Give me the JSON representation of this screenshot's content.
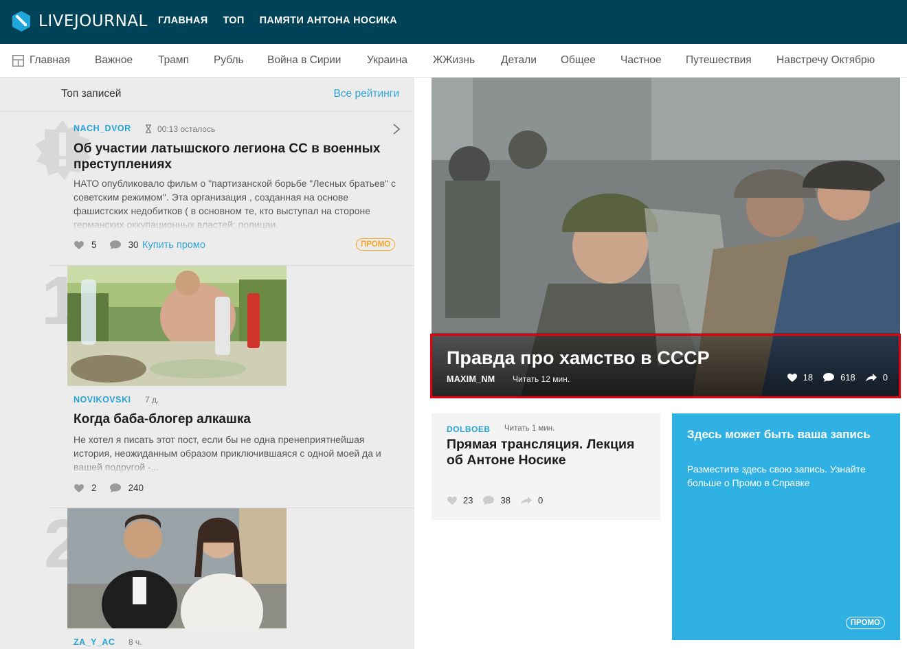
{
  "header": {
    "logo_text": "LIVEJOURNAL",
    "nav": [
      "ГЛАВНАЯ",
      "ТОП",
      "ПАМЯТИ АНТОНА НОСИКА"
    ]
  },
  "categories": [
    "Главная",
    "Важное",
    "Трамп",
    "Рубль",
    "Война в Сирии",
    "Украина",
    "ЖЖизнь",
    "Детали",
    "Общее",
    "Частное",
    "Путешествия",
    "Навстречу Октябрю"
  ],
  "left": {
    "title": "Топ записей",
    "link": "Все рейтинги",
    "entries": [
      {
        "author": "NACH_DVOR",
        "meta": "00:13 осталось",
        "title": "Об участии латышского легиона СС в военных преступлениях",
        "text": "НАТО опубликовало фильм о \"партизанской борьбе \"Лесных братьев\" с советским режимом\". Эта организация , созданная на основе фашистских недобитков ( в основном те, кто выступал на стороне германских оккупационных властей: полицаи,",
        "likes": "5",
        "comments": "30",
        "promo_link": "Купить промо",
        "badge": "ПРОМО"
      },
      {
        "rank": "1",
        "author": "NOVIKOVSKI",
        "meta": "7 д.",
        "title": "Когда баба-блогер алкашка",
        "text": "Не хотел я писать этот пост, если бы не одна пренеприятнейшая история, неожиданным образом приключившаяся с одной моей да и вашей подругой -...",
        "likes": "2",
        "comments": "240"
      },
      {
        "rank": "2",
        "author": "ZA_Y_AC",
        "meta": "8 ч."
      }
    ]
  },
  "featured": {
    "title": "Правда про хамство в СССР",
    "author": "MAXIM_NM",
    "read": "Читать 12 мин.",
    "likes": "18",
    "comments": "618",
    "shares": "0"
  },
  "card": {
    "author": "DOLBOEB",
    "read": "Читать 1 мин.",
    "title": "Прямая трансляция. Лекция об Антоне Носике",
    "likes": "23",
    "comments": "38",
    "shares": "0"
  },
  "promo": {
    "title": "Здесь может быть ваша запись",
    "text": "Разместите здесь свою запись. Узнайте больше о Промо в Справке",
    "tag": "ПРОМО"
  },
  "colors": {
    "header_bg": "#004359",
    "link": "#2ea5d7",
    "promo_bg": "#2fb1e3",
    "promo_badge": "#f5a623",
    "highlight": "#e6000e"
  }
}
